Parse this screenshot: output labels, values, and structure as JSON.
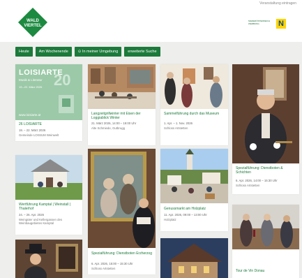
{
  "header": {
    "logo_line1": "WALD",
    "logo_line2": "VIERTEL",
    "top_link": "Veranstaltung eintragen",
    "partner_text": "NIEDERÖSTERREICH WERBUNG",
    "partner_badge": "N",
    "brand_color": "#1c7a3b"
  },
  "filters": [
    {
      "label": "Heute"
    },
    {
      "label": "Am Wochenende"
    },
    {
      "label": "⊙ In meiner Umgebung"
    },
    {
      "label": "erweiterte Suche"
    }
  ],
  "events": [
    {
      "poster_title": "LOISIARTE",
      "poster_sub1": "Musik & Literatur",
      "poster_year": "20",
      "poster_dates": "19.–22. März 2026",
      "poster_site": "www.loisiarte.at",
      "title": "26 LOISIARTE",
      "date": "19. – 22. März 2026",
      "place": "Gemeinde LOISIUM Weinwelt"
    },
    {
      "title": "Langzeitgrillwinter mit Eisen der Loggiablick Winter",
      "date": "21. März 2026, 14:00 – 19:00 Uhr",
      "place": "Alte Schmiede, Gutbrugg"
    },
    {
      "title": "Sammelführung durch das Museum",
      "date": "1. Apr. – 1. Nov. 2026",
      "place": "Schloss Artstetten"
    },
    {
      "title": "Spezialführung: Dienstboten & Schichten",
      "date": "6. Apr. 2026, 14:00 – 15:30 Uhr",
      "place": "Schloss Artstetten"
    },
    {
      "title": "Wertführung Kamptal | Weinstall | Thalerhof",
      "date": "24. – 26. Apr. 2026",
      "place": "Weingüter und Kellergassen des Weinbaugebietes Kamptal"
    },
    {
      "title": "Spezialführung: Dienstboten Erzherzog",
      "date": "6. Apr. 2026, 15:00 – 15:30 Uhr",
      "place": "Schloss Artstetten"
    },
    {
      "title": "Genussmarkt am Holzplatz",
      "date": "11. Apr. 2026, 09:00 – 13:00 Uhr",
      "place": "Holzplatz"
    },
    {
      "title": "Tour de Vin Donau",
      "date": "",
      "place": ""
    },
    {
      "title": "",
      "date": "",
      "place": ""
    },
    {
      "title": "",
      "date": "",
      "place": ""
    }
  ]
}
